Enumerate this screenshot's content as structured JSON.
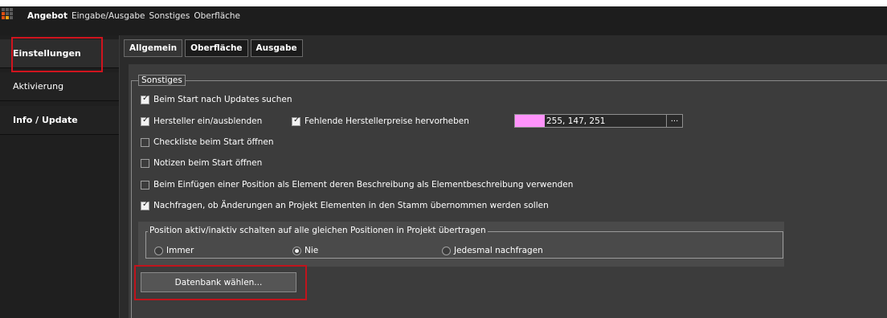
{
  "menubar": {
    "items": [
      "Angebot",
      "Eingabe/Ausgabe",
      "Sonstiges",
      "Oberfläche"
    ]
  },
  "sidenav": {
    "items": [
      {
        "label": "Einstellungen",
        "active": true
      },
      {
        "label": "Aktivierung",
        "active": false
      },
      {
        "label": "Info / Update",
        "active": false
      }
    ]
  },
  "tabs": [
    "Allgemein",
    "Oberfläche",
    "Ausgabe"
  ],
  "sonstiges": {
    "legend": "Sonstiges",
    "options": {
      "updates": {
        "label": "Beim Start nach Updates suchen",
        "checked": true
      },
      "hersteller": {
        "label": "Hersteller ein/ausblenden",
        "checked": true
      },
      "fehlende": {
        "label": "Fehlende Herstellerpreise hervorheben",
        "checked": true
      },
      "checkliste": {
        "label": "Checkliste beim Start öffnen",
        "checked": false
      },
      "notizen": {
        "label": "Notizen beim Start öffnen",
        "checked": false
      },
      "einfuegen": {
        "label": "Beim Einfügen einer Position als Element deren Beschreibung als Elementbeschreibung verwenden",
        "checked": false
      },
      "nachfragen": {
        "label": "Nachfragen, ob Änderungen an Projekt Elementen in den Stamm übernommen werden sollen",
        "checked": true
      }
    },
    "color": {
      "value": "255, 147, 251",
      "button": "...",
      "swatch_color": "#ff93fb"
    }
  },
  "position_group": {
    "legend": "Position aktiv/inaktiv schalten auf alle gleichen Positionen in Projekt übertragen",
    "options": [
      {
        "label": "Immer",
        "selected": false
      },
      {
        "label": "Nie",
        "selected": true
      },
      {
        "label": "Jedesmal nachfragen",
        "selected": false
      }
    ]
  },
  "database_button": "Datenbank wählen...",
  "colors": {
    "highlight": "#d0141e",
    "background": "#2b2b2b"
  }
}
